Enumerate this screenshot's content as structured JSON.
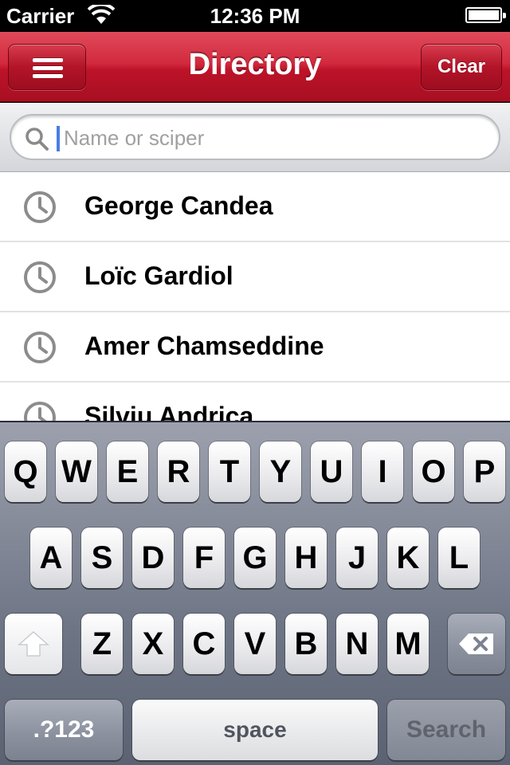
{
  "status_bar": {
    "carrier": "Carrier",
    "time": "12:36 PM"
  },
  "navbar": {
    "title": "Directory",
    "clear_label": "Clear",
    "menu_icon": "hamburger-menu-icon"
  },
  "search": {
    "placeholder": "Name or sciper",
    "value": "",
    "icon": "search-icon"
  },
  "recent_searches": {
    "icon": "clock-icon",
    "items": [
      {
        "name": "George Candea"
      },
      {
        "name": "Loïc Gardiol"
      },
      {
        "name": "Amer Chamseddine"
      },
      {
        "name": "Silviu Andrica"
      }
    ]
  },
  "keyboard": {
    "row1": [
      "Q",
      "W",
      "E",
      "R",
      "T",
      "Y",
      "U",
      "I",
      "O",
      "P"
    ],
    "row2": [
      "A",
      "S",
      "D",
      "F",
      "G",
      "H",
      "J",
      "K",
      "L"
    ],
    "row3": [
      "Z",
      "X",
      "C",
      "V",
      "B",
      "N",
      "M"
    ],
    "numbers_label": ".?123",
    "space_label": "space",
    "search_label": "Search"
  },
  "colors": {
    "navbar_accent": "#bd1329",
    "keyboard_bg": "#6e7585"
  }
}
